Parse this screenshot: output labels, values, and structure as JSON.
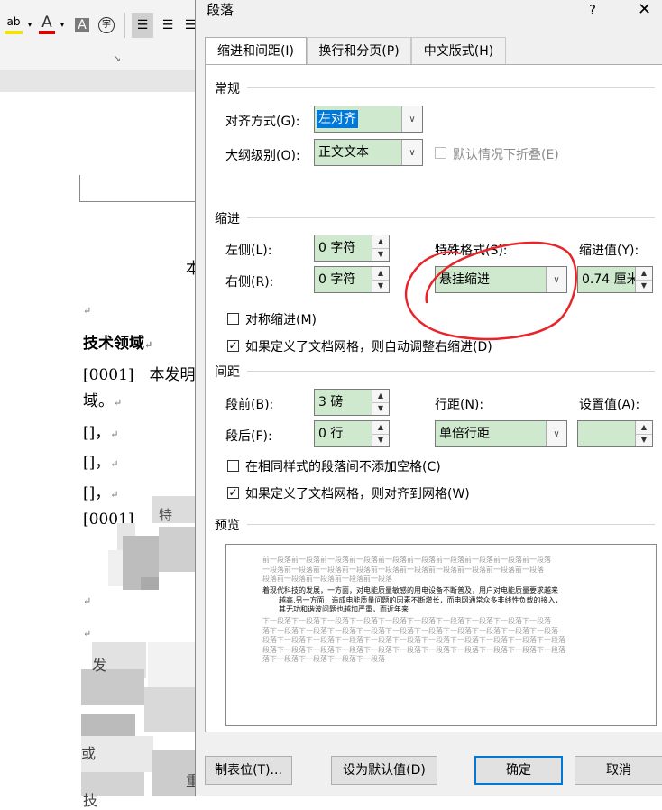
{
  "background_doc": {
    "heading": "技术领域",
    "para1_number": "[0001]",
    "para1_text": "本发明",
    "para1_cont": "域。",
    "bracket_1": "[]，",
    "bracket_2": "[]，",
    "bracket_3": "[]，",
    "para2_number": "[0001]",
    "para2_text": "特",
    "frag_fa": "发",
    "frag_huo": "或",
    "frag_zhong": "重",
    "frag_ji": "技",
    "frag_ben": "本",
    "para_mark": "↵"
  },
  "ribbon": {
    "highlight_icon": "ab",
    "font_color_icon": "A",
    "char_shading_icon": "A",
    "phonetic_icon": "字"
  },
  "dialog": {
    "title": "段落",
    "help": "?",
    "close": "✕",
    "tabs": [
      "缩进和间距(I)",
      "换行和分页(P)",
      "中文版式(H)"
    ],
    "general": {
      "section": "常规",
      "align_label": "对齐方式(G):",
      "align_value": "左对齐",
      "outline_label": "大纲级别(O):",
      "outline_value": "正文文本",
      "collapse_label": "默认情况下折叠(E)"
    },
    "indent": {
      "section": "缩进",
      "left_label": "左侧(L):",
      "left_value": "0 字符",
      "right_label": "右侧(R):",
      "right_value": "0 字符",
      "special_label": "特殊格式(S):",
      "special_value": "悬挂缩进",
      "by_label": "缩进值(Y):",
      "by_value": "0.74 厘米",
      "mirror_label": "对称缩进(M)",
      "auto_adjust_label": "如果定义了文档网格，则自动调整右缩进(D)"
    },
    "spacing": {
      "section": "间距",
      "before_label": "段前(B):",
      "before_value": "3 磅",
      "after_label": "段后(F):",
      "after_value": "0 行",
      "line_label": "行距(N):",
      "line_value": "单倍行距",
      "at_label": "设置值(A):",
      "at_value": "",
      "no_space_label": "在相同样式的段落间不添加空格(C)",
      "snap_grid_label": "如果定义了文档网格，则对齐到网格(W)"
    },
    "preview": {
      "section": "预览",
      "prev_lines": [
        "前一段落前一段落前一段落前一段落前一段落前一段落前一段落前一段落前一段落前一段落",
        "一段落前一段落前一段落前一段落前一段落前一段落前一段落前一段落前一段落前一段落",
        "段落前一段落前一段落前一段落前一段落"
      ],
      "sample_lines": [
        "着现代科技的发展，一方面，对电能质量敏感的用电设备不断普及，用户对电能质量要求越来",
        "越高,另一方面，造成电能质量问题的因素不断增长，而电网通常众多非线性负载的接入，",
        "其无功和谐波问题也越加严重，而近年来"
      ],
      "next_lines": [
        "下一段落下一段落下一段落下一段落下一段落下一段落下一段落下一段落下一段落下一段落",
        "落下一段落下一段落下一段落下一段落下一段落下一段落下一段落下一段落下一段落下一段落",
        "段落下一段落下一段落下一段落下一段落下一段落下一段落下一段落下一段落下一段落下一段落",
        "段落下一段落下一段落下一段落下一段落下一段落下一段落下一段落下一段落下一段落下一段落",
        "落下一段落下一段落下一段落下一段落"
      ]
    },
    "buttons": {
      "tabs": "制表位(T)...",
      "default": "设为默认值(D)",
      "ok": "确定",
      "cancel": "取消"
    }
  },
  "annotation": {
    "color": "#e8242a",
    "description": "red hand-drawn circle around 特殊格式 field"
  }
}
